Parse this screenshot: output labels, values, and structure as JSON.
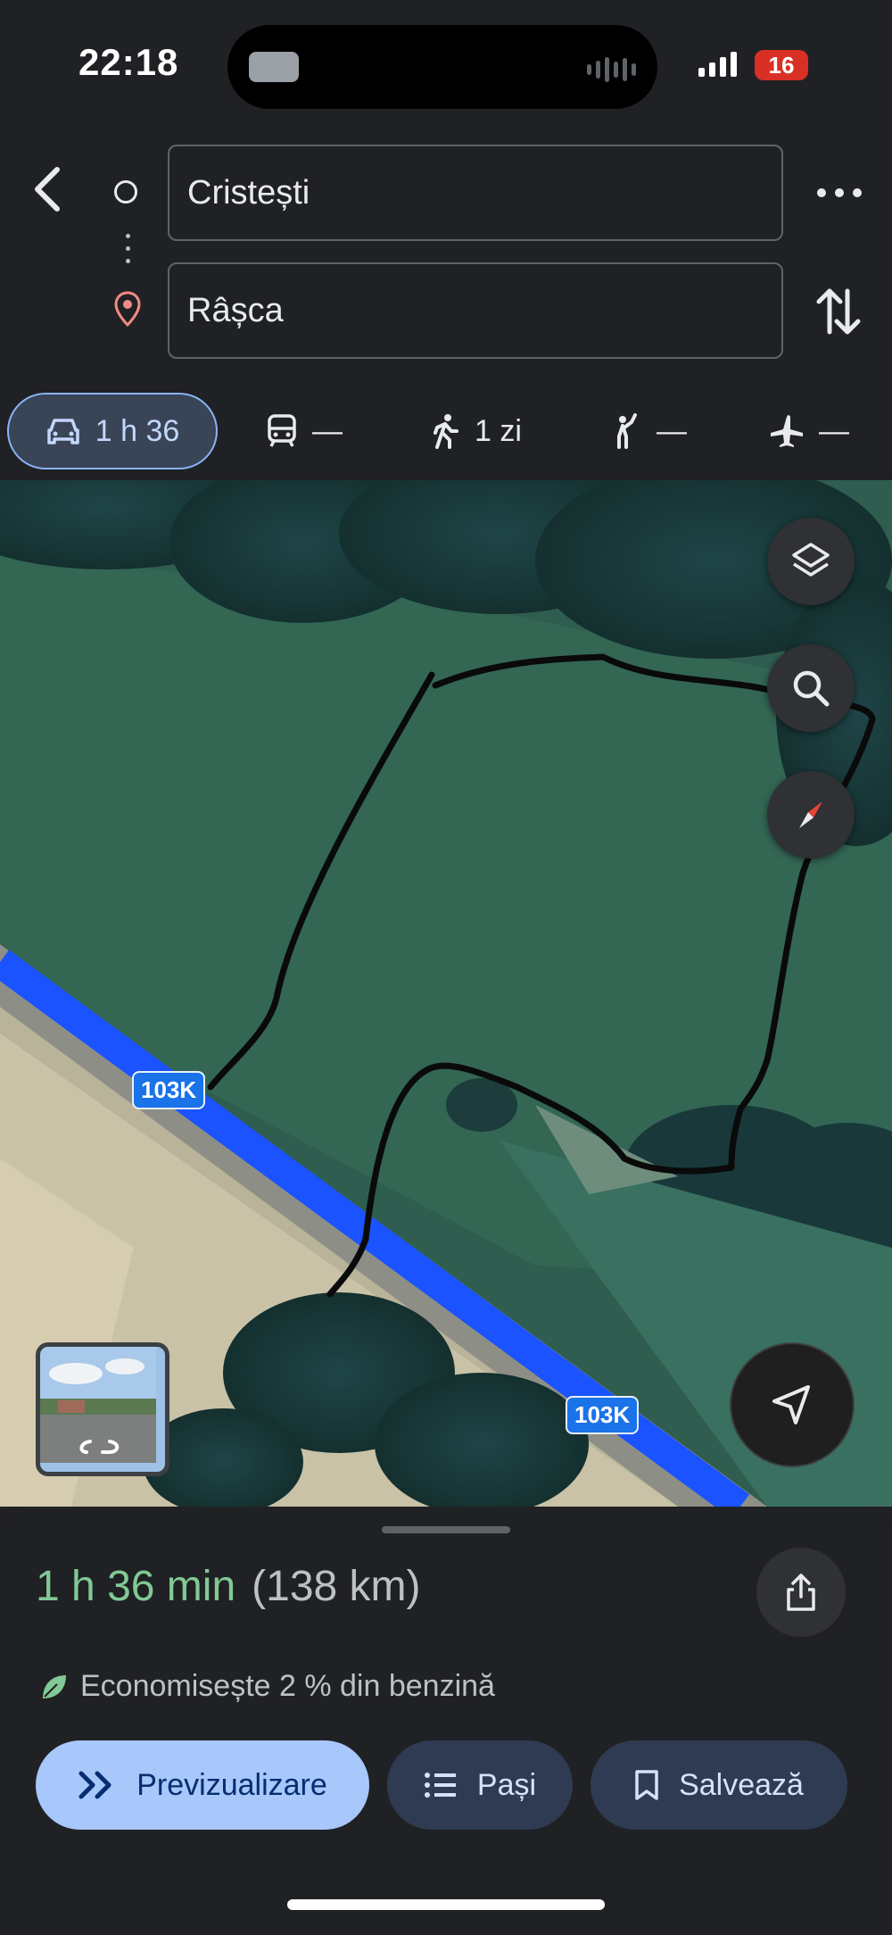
{
  "status_bar": {
    "time": "22:18",
    "battery": "16"
  },
  "directions": {
    "origin": "Cristești",
    "destination": "Râșca"
  },
  "modes": [
    {
      "name": "car",
      "label": "1 h 36",
      "active": true
    },
    {
      "name": "transit",
      "label": "—"
    },
    {
      "name": "walk",
      "label": "1 zi"
    },
    {
      "name": "rideshare",
      "label": "—"
    },
    {
      "name": "flight",
      "label": "—"
    }
  ],
  "map": {
    "road_label_1": "103K",
    "road_label_2": "103K",
    "route_color": "#1a53ff"
  },
  "summary": {
    "duration": "1 h 36 min",
    "distance": "(138 km)",
    "eco_note": "Economisește 2 % din benzină"
  },
  "actions": {
    "preview": "Previzualizare",
    "steps": "Pași",
    "save": "Salvează"
  }
}
